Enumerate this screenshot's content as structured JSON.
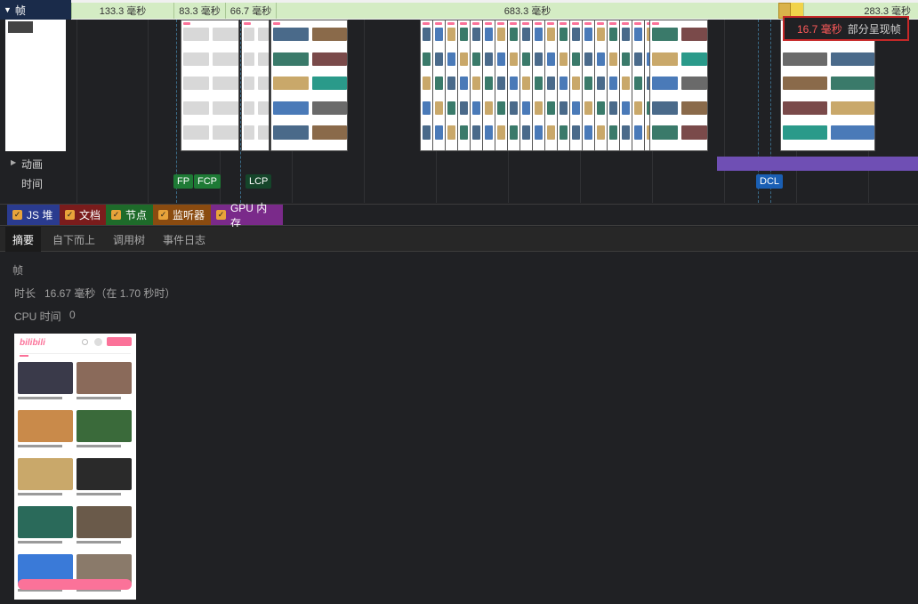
{
  "frames": {
    "label": "帧",
    "segments": [
      "133.3 毫秒",
      "83.3 毫秒",
      "66.7 毫秒",
      "683.3 毫秒",
      "283.3 毫秒"
    ]
  },
  "tooltip": {
    "duration": "16.7 毫秒",
    "description": "部分呈现帧"
  },
  "tracks": {
    "animation": "动画",
    "timings": "时间"
  },
  "markers": [
    "FP",
    "FCP",
    "LCP",
    "DCL"
  ],
  "legend": [
    "JS 堆",
    "文档",
    "节点",
    "监听器",
    "GPU 内存"
  ],
  "legend_colors": [
    "#2a3b8f",
    "#7a1c1c",
    "#1e6b2a",
    "#8a4b10",
    "#7a2a8a"
  ],
  "tabs": [
    "摘要",
    "自下而上",
    "调用树",
    "事件日志"
  ],
  "summary": {
    "title": "帧",
    "duration_label": "时长",
    "duration_value": "16.67 毫秒（在 1.70 秒时）",
    "cpu_label": "CPU 时间",
    "cpu_value": "0"
  },
  "preview": {
    "logo": "bilibili"
  }
}
